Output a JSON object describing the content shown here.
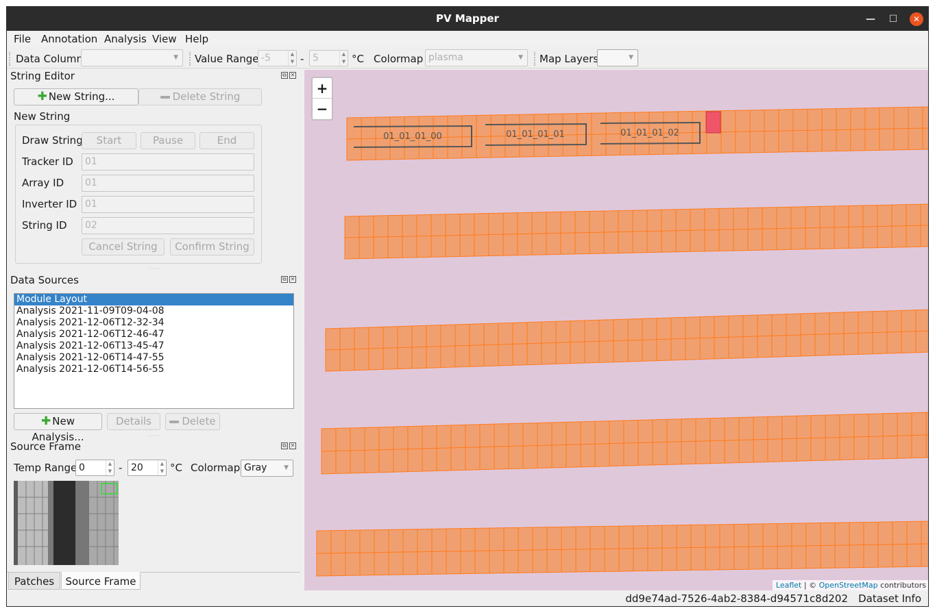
{
  "window": {
    "title": "PV Mapper"
  },
  "menu": [
    "File",
    "Annotation",
    "Analysis",
    "View",
    "Help"
  ],
  "toolbar": {
    "data_column_label": "Data Column",
    "data_column_value": "",
    "value_range_label": "Value Range",
    "range_min": "-5",
    "range_sep": "-",
    "range_max": "5",
    "unit": "°C",
    "colormap_label": "Colormap",
    "colormap_value": "plasma",
    "map_layers_label": "Map Layers",
    "map_layers_value": ""
  },
  "string_editor": {
    "title": "String Editor",
    "new_string_button": "New String...",
    "delete_string_button": "Delete String",
    "group_title": "New String",
    "draw_string_label": "Draw String",
    "start_button": "Start",
    "pause_button": "Pause",
    "end_button": "End",
    "tracker_id_label": "Tracker ID",
    "tracker_id_value": "01",
    "array_id_label": "Array ID",
    "array_id_value": "01",
    "inverter_id_label": "Inverter ID",
    "inverter_id_value": "01",
    "string_id_label": "String ID",
    "string_id_value": "02",
    "cancel_button": "Cancel String",
    "confirm_button": "Confirm String"
  },
  "data_sources": {
    "title": "Data Sources",
    "items": [
      "Module Layout",
      "Analysis 2021-11-09T09-04-08",
      "Analysis 2021-12-06T12-32-34",
      "Analysis 2021-12-06T12-46-47",
      "Analysis 2021-12-06T13-45-47",
      "Analysis 2021-12-06T14-47-55",
      "Analysis 2021-12-06T14-56-55"
    ],
    "selected_index": 0,
    "new_analysis_button": "New Analysis...",
    "details_button": "Details",
    "delete_button": "Delete"
  },
  "source_frame": {
    "title": "Source Frame",
    "temp_range_label": "Temp Range",
    "temp_min": "0",
    "temp_sep": "-",
    "temp_max": "20",
    "unit": "°C",
    "colormap_label": "Colormap",
    "colormap_value": "Gray"
  },
  "tabs": {
    "patches": "Patches",
    "source_frame": "Source Frame",
    "active": "source_frame"
  },
  "map": {
    "zoom_in": "+",
    "zoom_out": "−",
    "string_labels": [
      "01_01_01_00",
      "01_01_01_01",
      "01_01_01_02"
    ],
    "attribution_leaflet": "Leaflet",
    "attribution_sep": " | © ",
    "attribution_osm": "OpenStreetMap",
    "attribution_rest": " contributors",
    "colors": {
      "background": "#e0c8db",
      "module_fill": "#f0a070",
      "module_stroke": "#ff7a1a",
      "selected_fill": "#ee5566"
    }
  },
  "statusbar": {
    "dataset_id": "dd9e74ad-7526-4ab2-8384-d94571c8d202",
    "dataset_info": "Dataset Info"
  }
}
